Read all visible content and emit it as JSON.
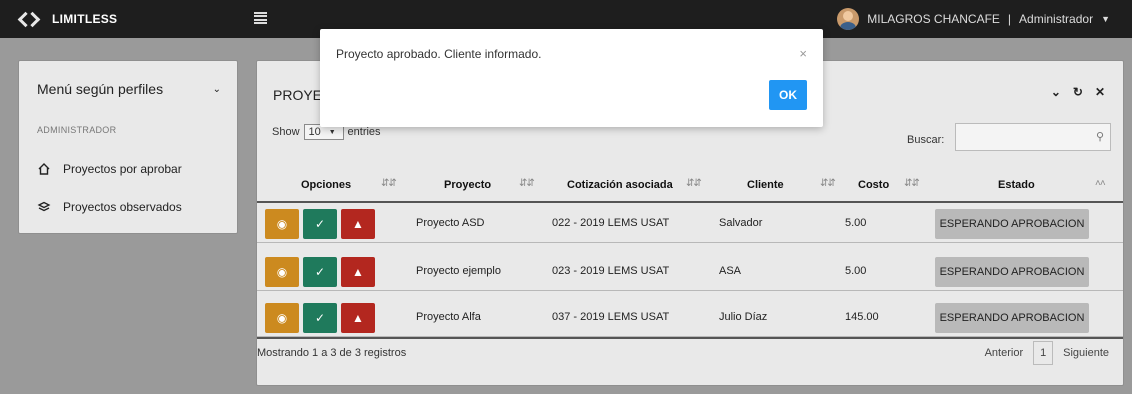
{
  "navbar": {
    "brand": "LIMITLESS",
    "user_name": "MILAGROS CHANCAFE",
    "separator": "|",
    "user_role": "Administrador"
  },
  "sidebar": {
    "title": "Menú según perfiles",
    "section": "ADMINISTRADOR",
    "items": [
      {
        "label": "Proyectos por aprobar",
        "icon": "home-icon"
      },
      {
        "label": "Proyectos observados",
        "icon": "layers-icon"
      }
    ]
  },
  "panel": {
    "title_visible": "PROYEC",
    "show_label": "Show",
    "show_value": "10",
    "entries_label": "entries",
    "search_label": "Buscar:",
    "search_value": ""
  },
  "table": {
    "columns": [
      "Opciones",
      "Proyecto",
      "Cotización asociada",
      "Cliente",
      "Costo",
      "Estado"
    ],
    "rows": [
      {
        "proyecto": "Proyecto ASD",
        "cotizacion": "022 - 2019 LEMS USAT",
        "cliente": "Salvador",
        "costo": "5.00",
        "estado": "ESPERANDO APROBACION"
      },
      {
        "proyecto": "Proyecto ejemplo",
        "cotizacion": "023 - 2019 LEMS USAT",
        "cliente": "ASA",
        "costo": "5.00",
        "estado": "ESPERANDO APROBACION"
      },
      {
        "proyecto": "Proyecto Alfa",
        "cotizacion": "037 - 2019 LEMS USAT",
        "cliente": "Julio Díaz",
        "costo": "145.00",
        "estado": "ESPERANDO APROBACION"
      }
    ],
    "info": "Mostrando 1 a 3 de 3 registros",
    "prev": "Anterior",
    "page": "1",
    "next": "Siguiente"
  },
  "modal": {
    "message": "Proyecto aprobado. Cliente informado.",
    "close": "×",
    "ok_label": "OK"
  },
  "colors": {
    "navbar": "#1e1e1e",
    "view_button": "#cc8a1f",
    "approve_button": "#1f7a5c",
    "observe_button": "#b3271f",
    "ok_button": "#2196f3",
    "status_badge": "#b9b9b9"
  }
}
